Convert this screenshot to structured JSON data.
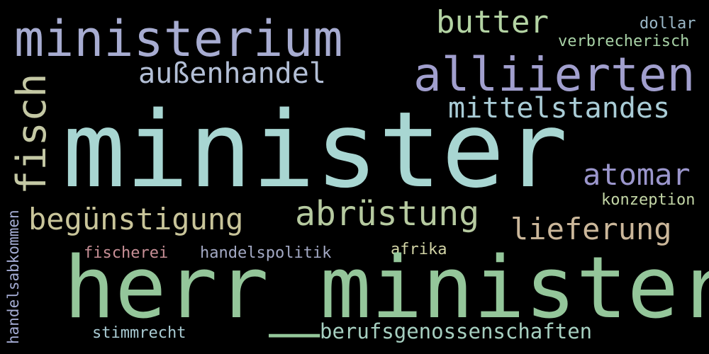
{
  "words": [
    {
      "text": "ministerium",
      "color": "#a7acd1"
    },
    {
      "text": "butter",
      "color": "#b3d3a3"
    },
    {
      "text": "dollar",
      "color": "#9bb8c8"
    },
    {
      "text": "verbrecherisch",
      "color": "#a8d2a6"
    },
    {
      "text": "alliierten",
      "color": "#a19fce"
    },
    {
      "text": "außenhandel",
      "color": "#b3bfd6"
    },
    {
      "text": "mittelstandes",
      "color": "#a9ccd6"
    },
    {
      "text": "minister",
      "color": "#a8d6d2"
    },
    {
      "text": "fisch",
      "color": "#c4c8a4"
    },
    {
      "text": "atomar",
      "color": "#9b96cc"
    },
    {
      "text": "konzeption",
      "color": "#c3d6a6"
    },
    {
      "text": "abrüstung",
      "color": "#b6caa0"
    },
    {
      "text": "begünstigung",
      "color": "#c9c59a"
    },
    {
      "text": "lieferung",
      "color": "#cbb79a"
    },
    {
      "text": "fischerei",
      "color": "#c78f96"
    },
    {
      "text": "handelspolitik",
      "color": "#a3a9c4"
    },
    {
      "text": "afrika",
      "color": "#d2d4a6"
    },
    {
      "text": "herr_minister",
      "color": "#94c69a"
    },
    {
      "text": "berufsgenossenschaften",
      "color": "#a6cfc0"
    },
    {
      "text": "stimmrecht",
      "color": "#a9cbd3"
    },
    {
      "text": "handelsabkommen",
      "color": "#a4acd4"
    }
  ]
}
